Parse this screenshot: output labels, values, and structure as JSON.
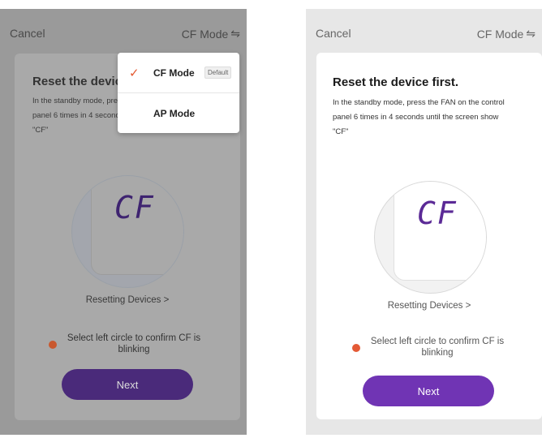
{
  "left": {
    "cancel_label": "Cancel",
    "mode_label": "CF Mode",
    "swap_icon": "⇋",
    "title": "Reset the device",
    "description": "In the standby mode, press the FAN on the control panel 6 times in 4 seconds until the screen show \"CF\"",
    "cf_text": "CF",
    "resetting_link": "Resetting Devices >",
    "confirm_text": "Select left circle to confirm CF is blinking",
    "next_label": "Next",
    "dropdown": {
      "items": [
        {
          "label": "CF Mode",
          "badge": "Default",
          "checked": true
        },
        {
          "label": "AP Mode",
          "badge": "",
          "checked": false
        }
      ],
      "tick_icon": "✓"
    }
  },
  "right": {
    "cancel_label": "Cancel",
    "mode_label": "CF Mode",
    "swap_icon": "⇋",
    "title": "Reset the device first.",
    "description": "In the standby mode, press the FAN on the control panel 6 times in 4 seconds until the screen show \"CF\"",
    "cf_text": "CF",
    "resetting_link": "Resetting Devices >",
    "confirm_text": "Select left circle to confirm CF is blinking",
    "next_label": "Next"
  },
  "colors": {
    "accent_purple": "#7034b4",
    "check_orange": "#e4582f",
    "overlay_gray": "#9a9a9a"
  }
}
